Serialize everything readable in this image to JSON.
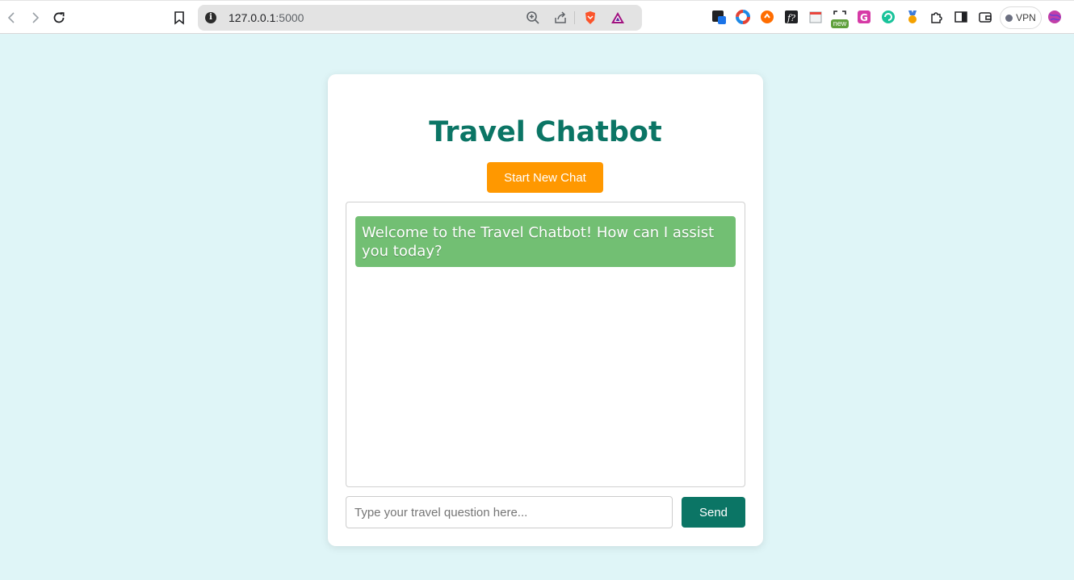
{
  "browser": {
    "address": {
      "host": "127.0.0.1",
      "port": ":5000"
    },
    "vpn_label": "VPN",
    "extensions": [
      {
        "name": "bitwarden-icon",
        "color": "#1a73e8"
      },
      {
        "name": "color-wheel-icon",
        "color": "#e34234"
      },
      {
        "name": "extension-orange-icon",
        "color": "#ff6d00"
      },
      {
        "name": "font-icon",
        "color": "#202124"
      },
      {
        "name": "calendar-icon",
        "color": "#e8eaed"
      },
      {
        "name": "screenshot-icon",
        "color": "#5fa03b"
      },
      {
        "name": "grammarly-g-icon",
        "color": "#d63aa6"
      },
      {
        "name": "refresh-green-icon",
        "color": "#19c39a"
      },
      {
        "name": "medal-icon",
        "color": "#f4a100"
      }
    ],
    "new_badge": "new"
  },
  "chat": {
    "title": "Travel Chatbot",
    "new_chat_label": "Start New Chat",
    "welcome_message": "Welcome to the Travel Chatbot! How can I assist you today?",
    "input_placeholder": "Type your travel question here...",
    "input_value": "",
    "send_label": "Send"
  },
  "colors": {
    "background": "#dff5f7",
    "title": "#0b7565",
    "new_chat_button": "#ff9800",
    "bot_bubble": "#72bf73",
    "send_button": "#0b7565"
  }
}
